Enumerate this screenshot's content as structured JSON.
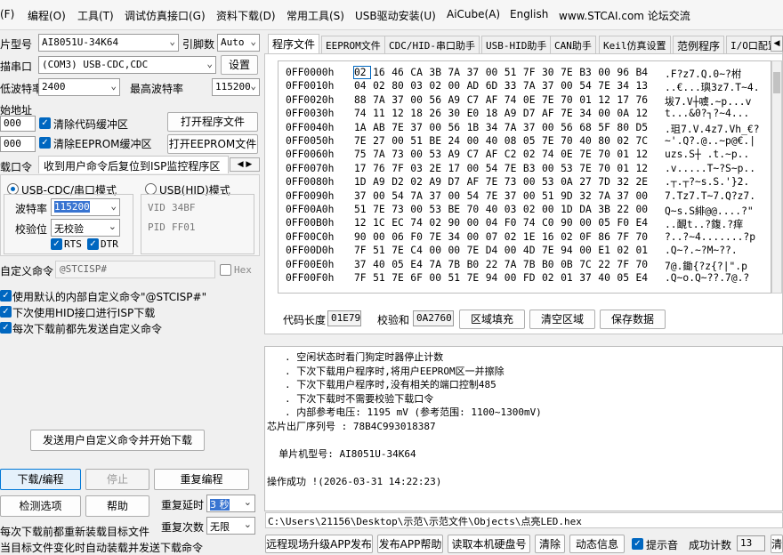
{
  "menu": [
    "(F)",
    "编程(O)",
    "工具(T)",
    "调试仿真接口(G)",
    "资料下载(D)",
    "常用工具(S)",
    "USB驱动安装(U)",
    "AiCube(A)",
    "English",
    "www.STCAI.com 论坛交流"
  ],
  "left": {
    "mcu_label": "片型号",
    "mcu_value": "AI8051U-34K64",
    "pin_label": "引脚数",
    "pin_value": "Auto",
    "port_label": "描串口",
    "port_value": "(COM3) USB-CDC,CDC",
    "settings_button": "设置",
    "min_baud_label": "低波特率",
    "min_baud_value": "2400",
    "max_baud_label": "最高波特率",
    "max_baud_value": "115200",
    "start_addr_label": "始地址",
    "addr1": "000",
    "addr2": "000",
    "clear_code_label": "清除代码缓冲区",
    "clear_eeprom_label": "清除EEPROM缓冲区",
    "open_program_button": "打开程序文件",
    "open_eeprom_button": "打开EEPROM文件",
    "cmd_tab_label": "载口令",
    "cmd_tab_text": "收到用户命令后复位到ISP监控程序区",
    "usb_cdc_mode": "USB-CDC/串口模式",
    "usb_hid_mode": "USB(HID)模式",
    "baud_label": "波特率",
    "baud_value": "115200",
    "parity_label": "校验位",
    "parity_value": "无校验",
    "rts_label": "RTS",
    "dtr_label": "DTR",
    "vid_label": "VID",
    "vid_value": "34BF",
    "pid_label": "PID",
    "pid_value": "FF01",
    "custom_cmd_label": "自定义命令",
    "custom_cmd_value": "@STCISP#",
    "hex_label": "Hex",
    "opt1": "使用默认的内部自定义命令\"@STCISP#\"",
    "opt2": "下次使用HID接口进行ISP下载",
    "opt3": "每次下载前都先发送自定义命令",
    "send_cmd_button": "发送用户自定义命令并开始下载",
    "download_button": "下载/编程",
    "stop_button": "停止",
    "reprogram_button": "重复编程",
    "check_button": "检测选项",
    "help_button": "帮助",
    "repeat_delay_label": "重复延时",
    "repeat_delay_value": "3 秒",
    "repeat_count_label": "重复次数",
    "repeat_count_value": "无限",
    "reload_line1": "每次下载前都重新装载目标文件",
    "reload_line2": "当目标文件变化时自动装载并发送下载命令"
  },
  "tabs": [
    "程序文件",
    "EEPROM文件",
    "CDC/HID-串口助手",
    "USB-HID助手",
    "CAN助手",
    "Keil仿真设置",
    "范例程序",
    "I/O口配置"
  ],
  "hex": {
    "rows": [
      {
        "addr": "0FF0000h",
        "bytes": [
          "02",
          "16",
          "46",
          "CA",
          "3B",
          "7A",
          "37",
          "00",
          "51",
          "7F",
          "30",
          "7E",
          "B3",
          "00",
          "96",
          "B4"
        ],
        "ascii": ".F?z7.Q.0~?柎"
      },
      {
        "addr": "0FF0010h",
        "bytes": [
          "04",
          "02",
          "80",
          "03",
          "02",
          "00",
          "AD",
          "6D",
          "33",
          "7A",
          "37",
          "00",
          "54",
          "7E",
          "34",
          "13"
        ],
        "ascii": "..€...璵3z7.T~4."
      },
      {
        "addr": "0FF0020h",
        "bytes": [
          "88",
          "7A",
          "37",
          "00",
          "56",
          "A9",
          "C7",
          "AF",
          "74",
          "0E",
          "7E",
          "70",
          "01",
          "12",
          "17",
          "76"
        ],
        "ascii": "坺7.V┼噳.~p...v"
      },
      {
        "addr": "0FF0030h",
        "bytes": [
          "74",
          "11",
          "12",
          "18",
          "26",
          "30",
          "E0",
          "18",
          "A9",
          "D7",
          "AF",
          "7E",
          "34",
          "00",
          "0A",
          "12"
        ],
        "ascii": "t...&0?┐?~4..."
      },
      {
        "addr": "0FF0040h",
        "bytes": [
          "1A",
          "AB",
          "7E",
          "37",
          "00",
          "56",
          "1B",
          "34",
          "7A",
          "37",
          "00",
          "56",
          "68",
          "5F",
          "80",
          "D5"
        ],
        "ascii": ".珇7.V.4z7.Vh_€?"
      },
      {
        "addr": "0FF0050h",
        "bytes": [
          "7E",
          "27",
          "00",
          "51",
          "BE",
          "24",
          "00",
          "40",
          "08",
          "05",
          "7E",
          "70",
          "40",
          "80",
          "02",
          "7C"
        ],
        "ascii": "~'.Q?.@..~p@€.|"
      },
      {
        "addr": "0FF0060h",
        "bytes": [
          "75",
          "7A",
          "73",
          "00",
          "53",
          "A9",
          "C7",
          "AF",
          "C2",
          "02",
          "74",
          "0E",
          "7E",
          "70",
          "01",
          "12"
        ],
        "ascii": "uzs.S┼ .t.~p.."
      },
      {
        "addr": "0FF0070h",
        "bytes": [
          "17",
          "76",
          "7F",
          "03",
          "2E",
          "17",
          "00",
          "54",
          "7E",
          "B3",
          "00",
          "53",
          "7E",
          "70",
          "01",
          "12"
        ],
        "ascii": ".v.....T~?S~p.."
      },
      {
        "addr": "0FF0080h",
        "bytes": [
          "1D",
          "A9",
          "D2",
          "02",
          "A9",
          "D7",
          "AF",
          "7E",
          "73",
          "00",
          "53",
          "0A",
          "27",
          "7D",
          "32",
          "2E"
        ],
        "ascii": ".┬.┬?~s.S.'}2."
      },
      {
        "addr": "0FF0090h",
        "bytes": [
          "37",
          "00",
          "54",
          "7A",
          "37",
          "00",
          "54",
          "7E",
          "37",
          "00",
          "51",
          "9D",
          "32",
          "7A",
          "37",
          "00"
        ],
        "ascii": "7.Tz7.T~7.Q?z7."
      },
      {
        "addr": "0FF00A0h",
        "bytes": [
          "51",
          "7E",
          "73",
          "00",
          "53",
          "BE",
          "70",
          "40",
          "03",
          "02",
          "00",
          "1D",
          "DA",
          "3B",
          "22",
          "00"
        ],
        "ascii": "Q~s.S緋@@....?\""
      },
      {
        "addr": "0FF00B0h",
        "bytes": [
          "12",
          "1C",
          "EC",
          "74",
          "02",
          "90",
          "00",
          "04",
          "F0",
          "74",
          "C0",
          "90",
          "00",
          "05",
          "F0",
          "E4"
        ],
        "ascii": "..靦t..?鍑.?痒"
      },
      {
        "addr": "0FF00C0h",
        "bytes": [
          "90",
          "00",
          "06",
          "F0",
          "7E",
          "34",
          "00",
          "07",
          "02",
          "1E",
          "16",
          "02",
          "0F",
          "86",
          "7F",
          "70"
        ],
        "ascii": "?..?~4.......?p"
      },
      {
        "addr": "0FF00D0h",
        "bytes": [
          "7F",
          "51",
          "7E",
          "C4",
          "00",
          "00",
          "7E",
          "D4",
          "00",
          "4D",
          "7E",
          "94",
          "00",
          "E1",
          "02",
          "01"
        ],
        "ascii": ".Q~?.~?M~??."
      },
      {
        "addr": "0FF00E0h",
        "bytes": [
          "37",
          "40",
          "05",
          "E4",
          "7A",
          "7B",
          "B0",
          "22",
          "7A",
          "7B",
          "B0",
          "0B",
          "7C",
          "22",
          "7F",
          "70"
        ],
        "ascii": "7@.鋤{?z{?|\".p"
      },
      {
        "addr": "0FF00F0h",
        "bytes": [
          "7F",
          "51",
          "7E",
          "6F",
          "00",
          "51",
          "7E",
          "94",
          "00",
          "FD",
          "02",
          "01",
          "37",
          "40",
          "05",
          "E4"
        ],
        "ascii": ".Q~o.Q~??.7@.?"
      }
    ],
    "code_len_label": "代码长度",
    "code_len_value": "01E79",
    "checksum_label": "校验和",
    "checksum_value": "0A2760",
    "fill_button": "区域填充",
    "clear_button": "清空区域",
    "save_button": "保存数据"
  },
  "log": [
    ". 空闲状态时看门狗定时器停止计数",
    ". 下次下载用户程序时,将用户EEPROM区一并擦除",
    ". 下次下载用户程序时,没有相关的端口控制485",
    ". 下次下载时不需要校验下载口令",
    ". 内部参考电压: 1195 mV (参考范围: 1100~1300mV)",
    "芯片出厂序列号 : 78B4C993018387",
    "",
    "  单片机型号: AI8051U-34K64",
    "",
    "操作成功 !(2026-03-31 14:22:23)"
  ],
  "file_path": "C:\\Users\\21156\\Desktop\\示范\\示范文件\\Objects\\点亮LED.hex",
  "bottom": {
    "upgrade_button": "远程现场升级APP发布",
    "help_button": "发布APP帮助",
    "read_disk_button": "读取本机硬盘号",
    "clear_button": "清除",
    "dynamic_button": "动态信息",
    "sound_label": "提示音",
    "success_label": "成功计数",
    "success_value": "13",
    "clear2_button": "清"
  }
}
